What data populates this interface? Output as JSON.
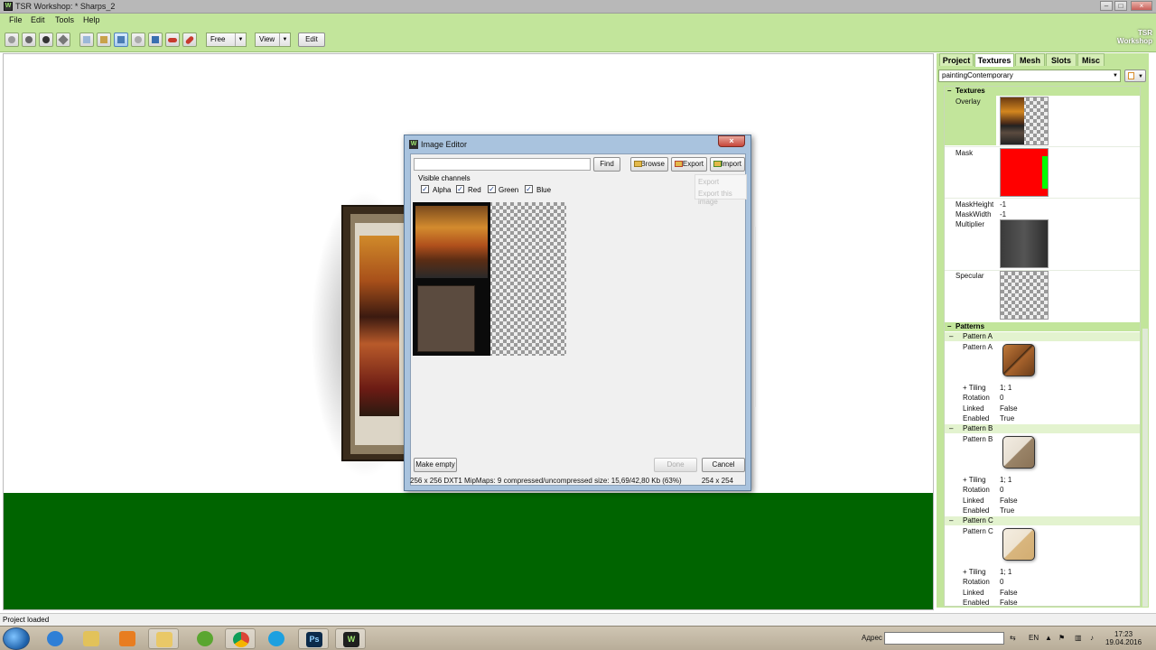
{
  "window": {
    "title": "TSR Workshop: * Sharps_2",
    "min": "–",
    "max": "□",
    "close": "×"
  },
  "menu": [
    "File",
    "Edit",
    "Tools",
    "Help"
  ],
  "toolbar": {
    "mode_value": "Free",
    "view_label": "View",
    "edit_label": "Edit",
    "logo_line1": "TSR",
    "logo_line2": "Workshop"
  },
  "dialog": {
    "title": "Image Editor",
    "find_label": "Find",
    "browse_label": "Browse",
    "export_label": "Export",
    "import_label": "Import",
    "visible_channels_label": "Visible channels",
    "channels": [
      "Alpha",
      "Red",
      "Green",
      "Blue"
    ],
    "export_menu": {
      "item1": "Export",
      "item2": "Export this image"
    },
    "make_empty_label": "Make empty",
    "done_label": "Done",
    "cancel_label": "Cancel",
    "status_info": "256 x 256 DXT1 MipMaps: 9 compressed/uncompressed size: 15,69/42,80 Kb (63%)",
    "size_info": "254 x 254"
  },
  "right_panel": {
    "tabs": [
      "Project",
      "Textures",
      "Mesh",
      "Slots",
      "Misc"
    ],
    "active_tab": "Textures",
    "texture_select": "paintingContemporary",
    "textures_category": "Textures",
    "overlay": "Overlay",
    "mask": "Mask",
    "mask_height": {
      "name": "MaskHeight",
      "value": "-1"
    },
    "mask_width": {
      "name": "MaskWidth",
      "value": "-1"
    },
    "multiplier": "Multiplier",
    "specular": "Specular",
    "patterns_category": "Patterns",
    "patterns": [
      {
        "header": "Pattern A",
        "label": "Pattern A",
        "tiling": "1; 1",
        "rotation": "0",
        "linked": "False",
        "enabled": "True"
      },
      {
        "header": "Pattern B",
        "label": "Pattern B",
        "tiling": "1; 1",
        "rotation": "0",
        "linked": "False",
        "enabled": "True"
      },
      {
        "header": "Pattern C",
        "label": "Pattern C",
        "tiling": "1; 1",
        "rotation": "0",
        "linked": "False",
        "enabled": "False"
      }
    ],
    "labels": {
      "tiling": "Tiling",
      "rotation": "Rotation",
      "linked": "Linked",
      "enabled": "Enabled"
    }
  },
  "status": "Project loaded",
  "taskbar": {
    "address_label": "Адрес",
    "lang": "EN",
    "time": "17:23",
    "date": "19.04.2016",
    "apps": [
      "ie-icon",
      "explorer-icon",
      "media-player-icon",
      "folder-icon",
      "utorrent-icon",
      "chrome-icon",
      "skype-icon",
      "photoshop-icon",
      "tsr-workshop-icon"
    ],
    "photoshop_glyph": "Ps",
    "workshop_glyph": "W"
  },
  "colors": {
    "accent_green": "#c2e59b",
    "ground": "#006400",
    "mask_red": "#ff0000",
    "mask_green": "#00ff00"
  }
}
